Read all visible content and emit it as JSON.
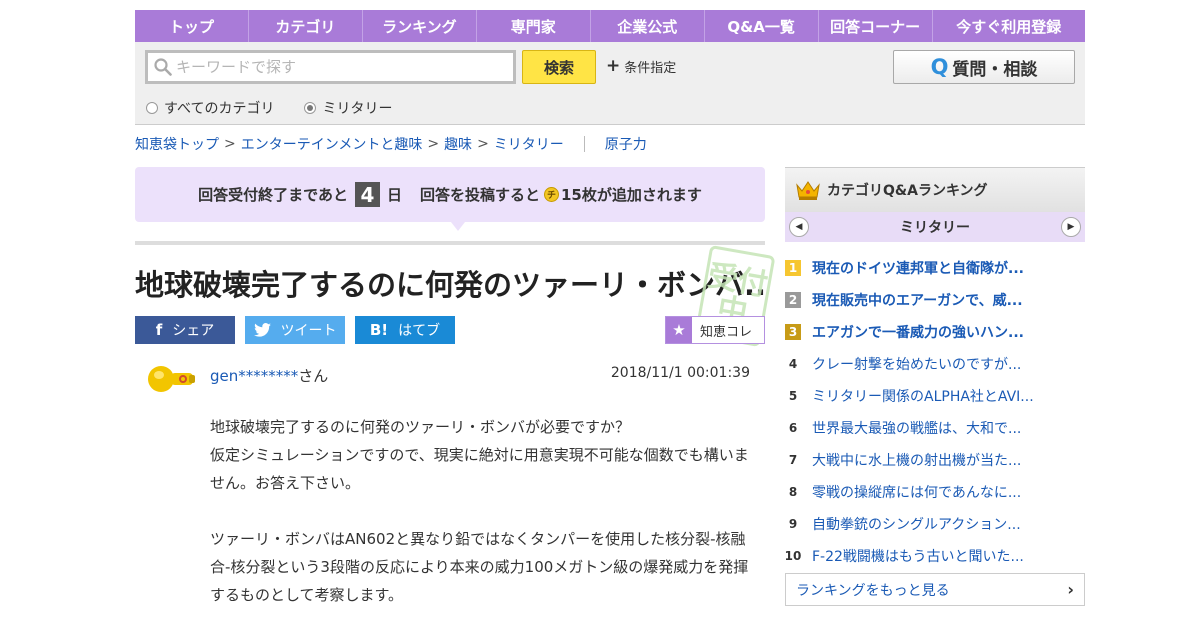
{
  "nav": {
    "items": [
      "トップ",
      "カテゴリ",
      "ランキング",
      "専門家",
      "企業公式",
      "Q&A一覧",
      "回答コーナー",
      "今すぐ利用登録"
    ]
  },
  "search": {
    "placeholder": "キーワードで探す",
    "button": "検索",
    "conditions": "条件指定",
    "ask_button": "質問・相談",
    "ask_icon": "Q",
    "radio_all": "すべてのカテゴリ",
    "radio_current": "ミリタリー"
  },
  "breadcrumb": {
    "items": [
      "知恵袋トップ",
      "エンターテインメントと趣味",
      "趣味",
      "ミリタリー"
    ],
    "separator": ">",
    "tag": "原子力"
  },
  "notice": {
    "prefix": "回答受付終了まであと",
    "days": "4",
    "days_unit": "日",
    "suffix_pre": "回答を投稿すると",
    "coin": "チ",
    "suffix": "15枚が追加されます"
  },
  "question": {
    "title": "地球破壊完了するのに何発のツァーリ・ボンバ...",
    "stamp": "受付中",
    "user": "gen********",
    "user_suffix": "さん",
    "date": "2018/11/1  00:01:39",
    "body": [
      "地球破壊完了するのに何発のツァーリ・ボンバが必要ですか？\n仮定シミュレーションですので、現実に絶対に用意実現不可能な個数でも構いません。お答え下さい。",
      "ツァーリ・ボンバはAN602と異なり鉛ではなくタンパーを使用した核分裂-核融合-核分裂という3段階の反応により本来の威力100メガトン級の爆発威力を発揮するものとして考察します。"
    ]
  },
  "share": {
    "facebook": "シェア",
    "facebook_icon": "f",
    "twitter": "ツイート",
    "twitter_icon": "twitter-bird",
    "hatena": "はてブ",
    "hatena_icon": "B!",
    "collect": "知恵コレ",
    "collect_icon": "★"
  },
  "ranking": {
    "title": "カテゴリQ&Aランキング",
    "category": "ミリタリー",
    "items": [
      {
        "rank": "1",
        "text": "現在のドイツ連邦軍と自衛隊が..."
      },
      {
        "rank": "2",
        "text": "現在販売中のエアーガンで、威..."
      },
      {
        "rank": "3",
        "text": "エアガンで一番威力の強いハン..."
      },
      {
        "rank": "4",
        "text": "クレー射撃を始めたいのですが..."
      },
      {
        "rank": "5",
        "text": "ミリタリー関係のALPHA社とAVI..."
      },
      {
        "rank": "6",
        "text": "世界最大最強の戦艦は、大和で..."
      },
      {
        "rank": "7",
        "text": "大戦中に水上機の射出機が当た..."
      },
      {
        "rank": "8",
        "text": "零戦の操縦席には何であんなに..."
      },
      {
        "rank": "9",
        "text": "自動拳銃のシングルアクション..."
      },
      {
        "rank": "10",
        "text": "F-22戦闘機はもう古いと聞いた..."
      }
    ],
    "more": "ランキングをもっと見る"
  },
  "colors": {
    "nav_bg": "#a97bd8",
    "link": "#1a5ab5",
    "search_button": "#ffe445",
    "notice_bg": "#ece1fb"
  }
}
